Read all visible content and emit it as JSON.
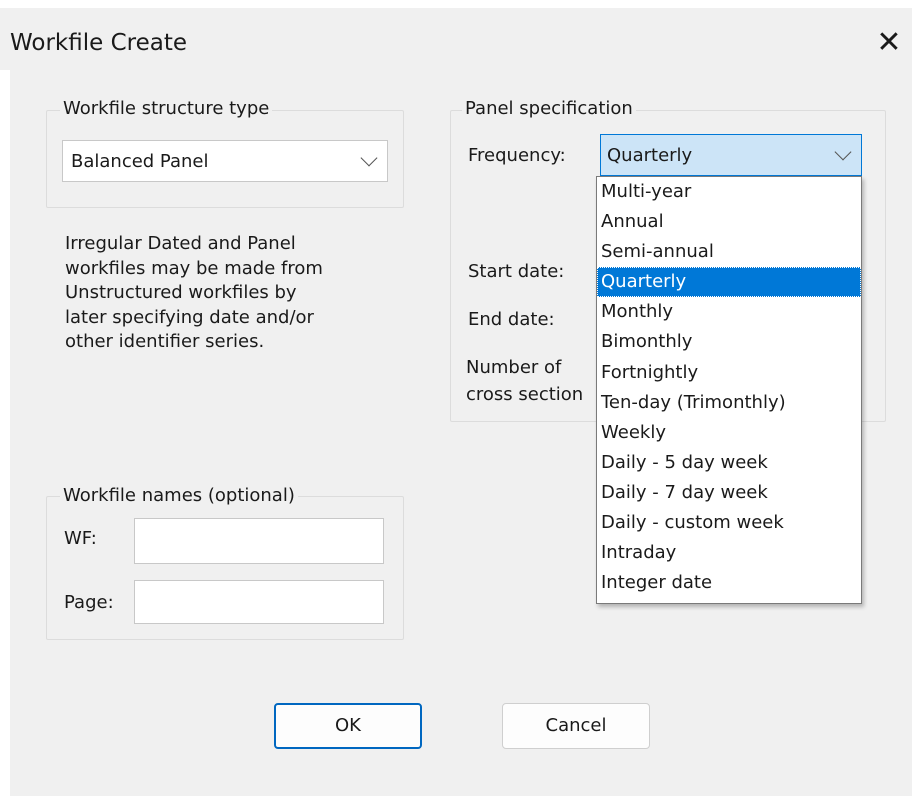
{
  "dialog": {
    "title": "Workfile Create",
    "close_label": "✕"
  },
  "structure": {
    "legend": "Workfile structure type",
    "selected": "Balanced Panel",
    "description": [
      "Irregular Dated and Panel",
      "workfiles may be made from",
      "Unstructured workfiles by",
      "later specifying date and/or",
      "other identifier series."
    ]
  },
  "panel": {
    "legend": "Panel specification",
    "frequency_label": "Frequency:",
    "frequency_value": "Quarterly",
    "start_date_label": "Start date:",
    "end_date_label": "End date:",
    "number_label_1": "Number of",
    "number_label_2": "cross section"
  },
  "frequency_options": [
    "Multi-year",
    "Annual",
    "Semi-annual",
    "Quarterly",
    "Monthly",
    "Bimonthly",
    "Fortnightly",
    "Ten-day (Trimonthly)",
    "Weekly",
    "Daily - 5 day week",
    "Daily - 7 day week",
    "Daily - custom week",
    "Intraday",
    "Integer date"
  ],
  "frequency_selected_index": 3,
  "names": {
    "legend": "Workfile names (optional)",
    "wf_label": "WF:",
    "wf_value": "",
    "page_label": "Page:",
    "page_value": ""
  },
  "buttons": {
    "ok": "OK",
    "cancel": "Cancel"
  },
  "colors": {
    "accent": "#0078d7",
    "dialog_bg": "#f0f0f0"
  }
}
